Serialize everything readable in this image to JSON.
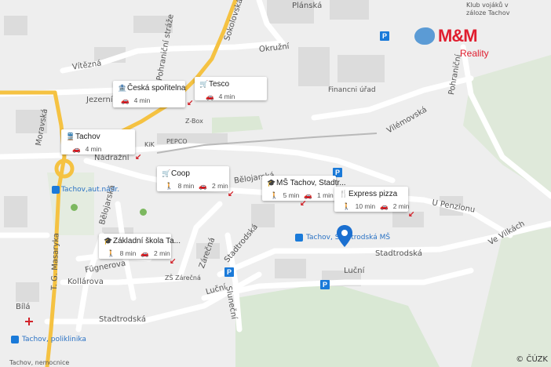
{
  "map": {
    "street_labels": {
      "vitezna": "Vítězná",
      "jezerni": "Jezerní",
      "moravska": "Moravská",
      "okruzni": "Okružní",
      "sokolovska": "Sokolovská",
      "pohranicni_straze": "Pohraniční stráže",
      "nadrazni": "Nádražní",
      "belojarska1": "Bělojarská",
      "belojarska2": "Bělojarská",
      "tg_masaryka": "T. G. Masaryka",
      "fugnerova": "Fügnerova",
      "kollarova": "Kollárova",
      "zarecna": "Zárečná",
      "stadtrodska1": "Stadtrodská",
      "stadtrodska2": "Stadtrodská",
      "stadtrodska3": "Stadtrodská",
      "lucni1": "Luční",
      "lucni2": "Luční",
      "slunecni": "Sluneční",
      "vilemovska": "Vilémovská",
      "u_penzionu": "U Penzionu",
      "ve_vilkach": "Ve Vilkách",
      "pohranicni2": "Pohraniční",
      "bila": "Bílá",
      "financni_urad": "Financni úřad",
      "zbox": "Z-Box",
      "kik": "KiK",
      "pepco": "PEPCO",
      "zs_zarecna": "ZŠ Zárečná",
      "klub": "Klub vojáků v záloze Tachov",
      "plana": "Plánská",
      "tachov_nemocnice": "Tachov, nemocnice",
      "zbox2": "Z-Box"
    },
    "transit_labels": {
      "bus1": "Tachov,aut.nádr.",
      "bus2": "Tachov, Stadtrodská MŠ",
      "bus3": "Tachov, poliklinika"
    },
    "copyright": "© ČÚZK"
  },
  "logo": {
    "text": "M&M",
    "sub": "Reality"
  },
  "cards": [
    {
      "title": "Česká spořitelna",
      "icon": "bank-icon",
      "walk": "",
      "drive": "4 min"
    },
    {
      "title": "Tesco",
      "icon": "cart-icon",
      "walk": "",
      "drive": "4 min"
    },
    {
      "title": "Tachov",
      "icon": "train-icon",
      "walk": "",
      "drive": "4 min"
    },
    {
      "title": "Coop",
      "icon": "cart-icon",
      "walk": "8 min",
      "drive": "2 min"
    },
    {
      "title": "MŠ Tachov, Stadtr...",
      "icon": "school-icon",
      "walk": "5 min",
      "drive": "1 min"
    },
    {
      "title": "Express pizza",
      "icon": "restaurant-icon",
      "walk": "10 min",
      "drive": "2 min"
    },
    {
      "title": "Základní škola Ta...",
      "icon": "school-icon",
      "walk": "8 min",
      "drive": "2 min"
    }
  ],
  "colors": {
    "road_major": "#f5c242",
    "road": "#ffffff",
    "park": "#d9e8d4",
    "water": "#5b9bd5",
    "accent": "#e01e2f",
    "transit": "#1a7ad9"
  },
  "parking_label": "P"
}
